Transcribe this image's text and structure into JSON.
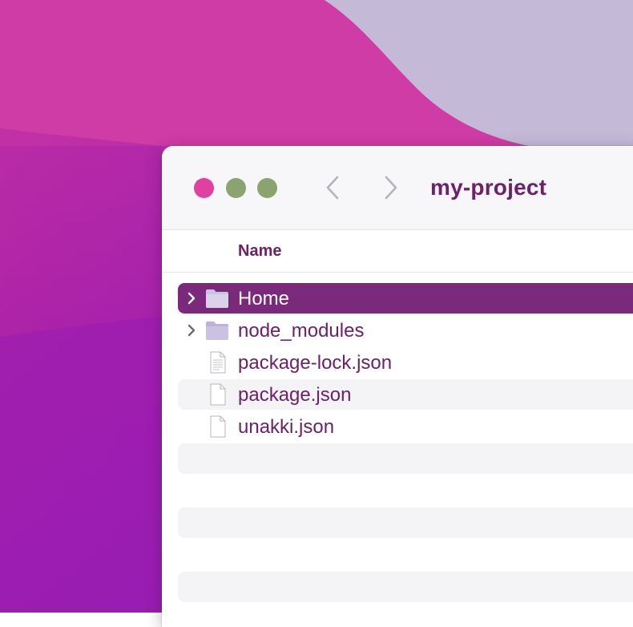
{
  "window": {
    "title": "my-project"
  },
  "toolbar": {
    "traffic_lights": [
      {
        "name": "close",
        "color": "#e0409f"
      },
      {
        "name": "minimize",
        "color": "#8aa36f"
      },
      {
        "name": "zoom",
        "color": "#8aa36f"
      }
    ],
    "back_icon": "chevron-left-icon",
    "forward_icon": "chevron-right-icon"
  },
  "list": {
    "column_header": "Name",
    "items": [
      {
        "label": "Home",
        "kind": "folder",
        "expandable": true,
        "selected": true
      },
      {
        "label": "node_modules",
        "kind": "folder",
        "expandable": true,
        "selected": false
      },
      {
        "label": "package-lock.json",
        "kind": "text-file",
        "expandable": false,
        "selected": false
      },
      {
        "label": "package.json",
        "kind": "file",
        "expandable": false,
        "selected": false
      },
      {
        "label": "unakki.json",
        "kind": "file",
        "expandable": false,
        "selected": false
      }
    ]
  },
  "colors": {
    "accent": "#6e2069",
    "selection": "#7b2a7b",
    "folder": "#c9c1dd",
    "desktop_magenta": "#c93aa5",
    "desktop_purple": "#8e1cb2",
    "desktop_lavender": "#c4bad8"
  }
}
